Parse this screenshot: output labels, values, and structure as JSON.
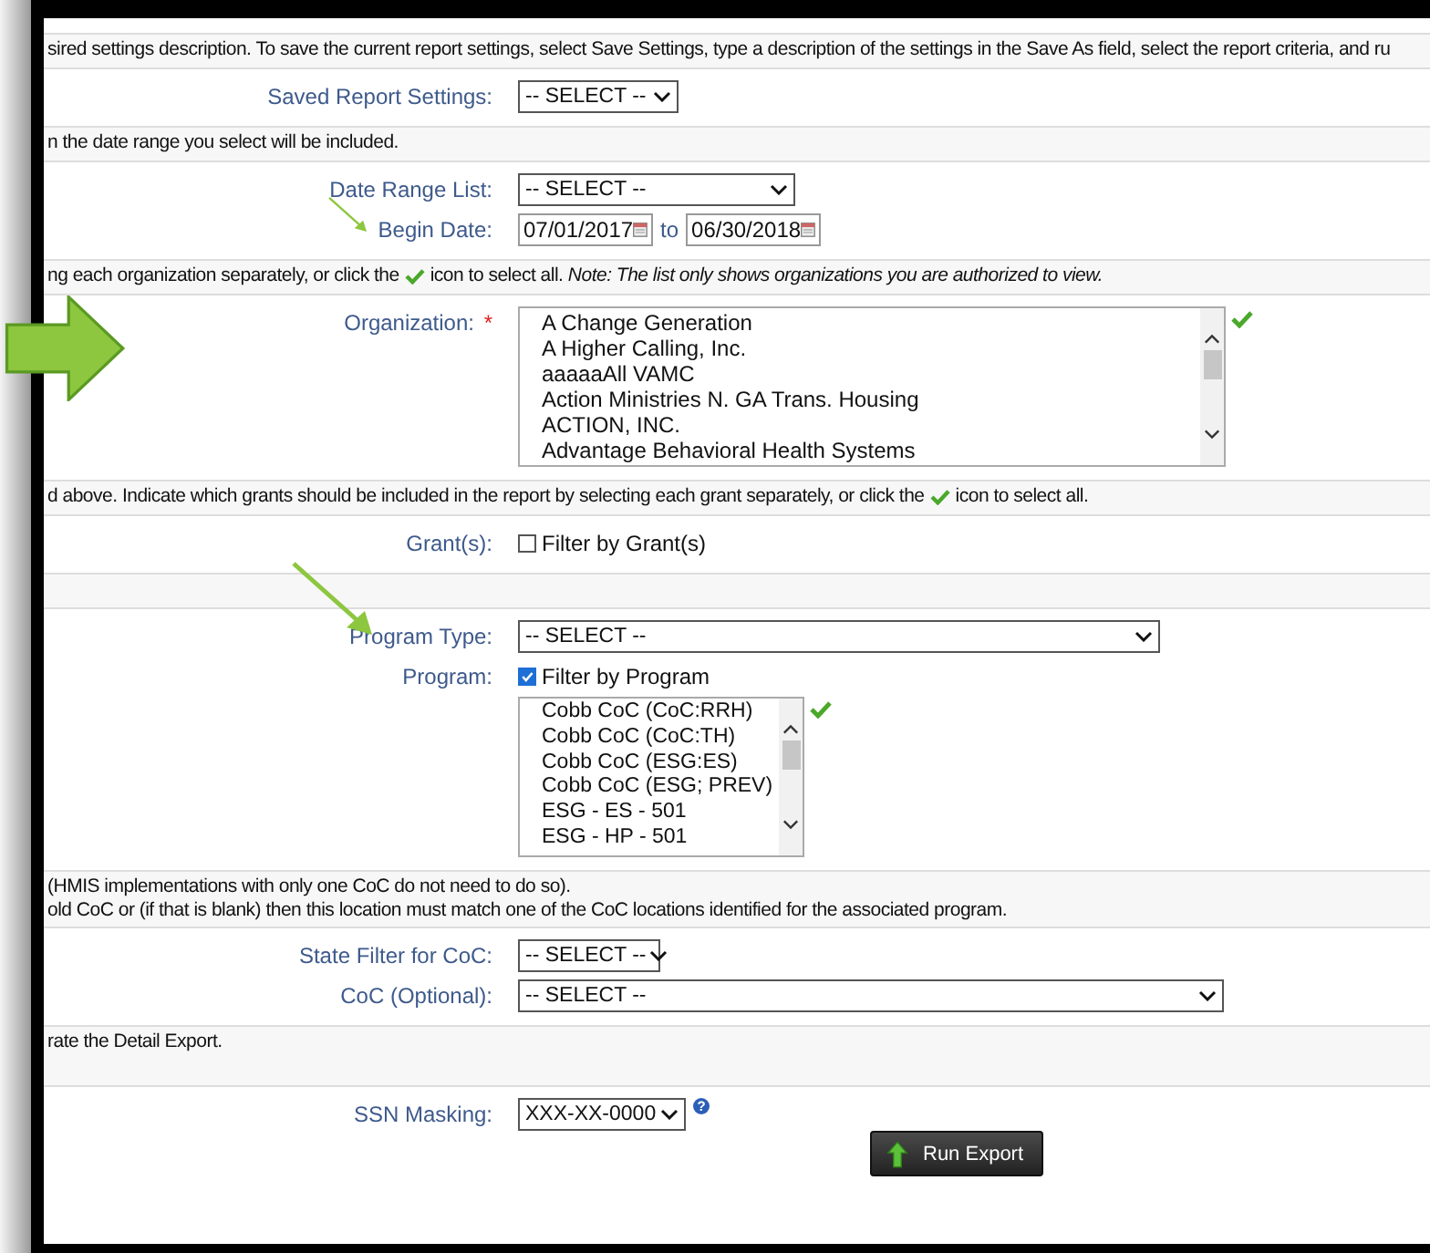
{
  "sections": [
    {
      "description": [
        [
          {
            "kind": "text",
            "text": "sired settings description. To save the current report settings, select Save Settings, type a description of the settings in the Save As field, select the report criteria, and ru"
          }
        ]
      ],
      "fields": [
        {
          "kind": "select",
          "label": "Saved Report Settings:",
          "value": "-- SELECT --"
        }
      ]
    },
    {
      "description": [
        [
          {
            "kind": "text",
            "text": "n the date range you select will be included."
          }
        ]
      ],
      "fields": [
        {
          "kind": "select",
          "label": "Date Range List:",
          "value": "-- SELECT --"
        },
        {
          "kind": "daterange",
          "label": "Begin Date:",
          "start": "07/01/2017",
          "separator": "to",
          "end": "06/30/2018"
        }
      ]
    },
    {
      "description": [
        [
          {
            "kind": "text",
            "text": "ng each organization separately, or click the"
          },
          {
            "kind": "check"
          },
          {
            "kind": "text",
            "text": "icon to select all. *Note: The list only shows organizations you are authorized to view.*"
          }
        ]
      ],
      "fields": [
        {
          "kind": "listbox",
          "label": "Organization:",
          "required_mark": "*",
          "select_all": true,
          "options": [
            "A Change Generation",
            "A Higher Calling, Inc.",
            "aaaaaAll VAMC",
            "Action Ministries N. GA Trans. Housing",
            "ACTION, INC.",
            "Advantage Behavioral Health Systems"
          ]
        }
      ]
    },
    {
      "description": [
        [
          {
            "kind": "text",
            "text": "d above. Indicate which grants should be included in the report by selecting each grant separately, or click the"
          },
          {
            "kind": "check"
          },
          {
            "kind": "text",
            "text": "icon to select all."
          }
        ]
      ],
      "fields": [
        {
          "kind": "checkbox",
          "label": "Grant(s):",
          "checkbox_label": "Filter by Grant(s)",
          "checked": false
        }
      ]
    },
    {
      "fields": [
        {
          "kind": "select",
          "label": "Program Type:",
          "value": "-- SELECT --"
        },
        {
          "kind": "checklist",
          "label": "Program:",
          "checkbox_label": "Filter by Program",
          "checked": true,
          "select_all": true,
          "options": [
            "Cobb CoC (CoC:RRH)",
            "Cobb CoC (CoC:TH)",
            "Cobb CoC (ESG:ES)",
            "Cobb CoC (ESG; PREV)",
            "ESG - ES - 501",
            "ESG - HP - 501"
          ]
        }
      ]
    },
    {
      "description": [
        [
          {
            "kind": "text",
            "text": "(HMIS implementations with only one CoC do not need to do so)."
          }
        ],
        [
          {
            "kind": "text",
            "text": "old CoC or (if that is blank) then this location must match one of the CoC locations identified for the associated program."
          }
        ]
      ],
      "fields": [
        {
          "kind": "select",
          "label": "State Filter for CoC:",
          "value": "-- SELECT --"
        },
        {
          "kind": "select",
          "label": "CoC (Optional):",
          "value": "-- SELECT --"
        }
      ]
    },
    {
      "description": [
        [
          {
            "kind": "text",
            "text": "rate the Detail Export."
          }
        ]
      ],
      "fields": [
        {
          "kind": "select",
          "label": "SSN Masking:",
          "value": "XXX-XX-0000",
          "help": "?"
        }
      ],
      "button": {
        "label": "Run Export"
      }
    }
  ]
}
